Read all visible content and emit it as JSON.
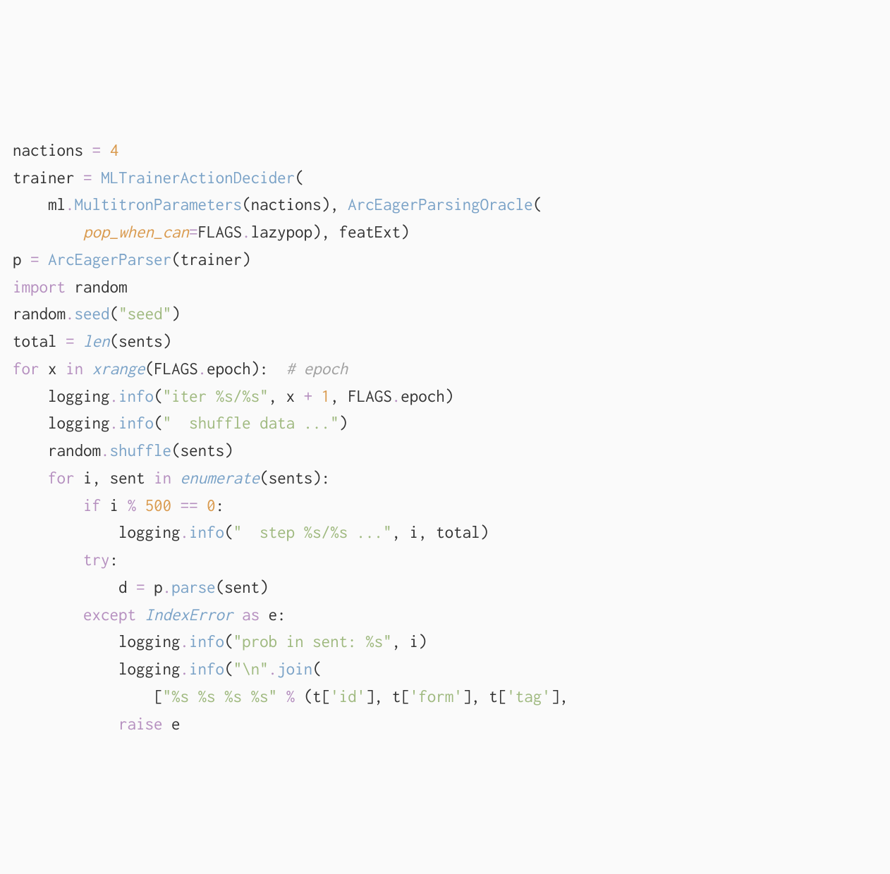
{
  "code": {
    "l1": {
      "var": "nactions",
      "eq": "=",
      "val": "4"
    },
    "l2": {
      "var": "trainer",
      "eq": "=",
      "cls": "MLTrainerActionDecider",
      "open": "("
    },
    "l3": {
      "obj": "ml",
      "dot": ".",
      "cls": "MultitronParameters",
      "open": "(",
      "arg": "nactions",
      "close": "), ",
      "cls2": "ArcEagerParsingOracle",
      "open2": "("
    },
    "l4": {
      "kwarg": "pop_when_can",
      "eq": "=",
      "obj": "FLAGS",
      "dot": ".",
      "attr": "lazypop",
      "close": "), ",
      "arg": "featExt",
      "close2": ")"
    },
    "l5": {
      "var": "p",
      "eq": "=",
      "cls": "ArcEagerParser",
      "open": "(",
      "arg": "trainer",
      "close": ")"
    },
    "l6": {
      "kw": "import",
      "mod": "random"
    },
    "l7": {
      "obj": "random",
      "dot": ".",
      "fn": "seed",
      "open": "(",
      "str": "\"seed\"",
      "close": ")"
    },
    "l8": {
      "var": "total",
      "eq": "=",
      "fn": "len",
      "open": "(",
      "arg": "sents",
      "close": ")"
    },
    "l9": {
      "kw": "for",
      "var": "x",
      "kw2": "in",
      "fn": "xrange",
      "open": "(",
      "obj": "FLAGS",
      "dot": ".",
      "attr": "epoch",
      "close": "):  ",
      "cmnt": "# epoch"
    },
    "l10": {
      "obj": "logging",
      "dot": ".",
      "fn": "info",
      "open": "(",
      "str": "\"iter %s/%s\"",
      "c1": ", ",
      "a1": "x",
      "op": "+",
      "n1": "1",
      "c2": ", ",
      "obj2": "FLAGS",
      "dot2": ".",
      "attr2": "epoch",
      "close": ")"
    },
    "l11": {
      "obj": "logging",
      "dot": ".",
      "fn": "info",
      "open": "(",
      "str": "\"  shuffle data ...\"",
      "close": ")"
    },
    "l12": {
      "obj": "random",
      "dot": ".",
      "fn": "shuffle",
      "open": "(",
      "arg": "sents",
      "close": ")"
    },
    "l13": {
      "kw": "for",
      "a1": "i",
      "c": ",",
      "a2": "sent",
      "kw2": "in",
      "fn": "enumerate",
      "open": "(",
      "arg": "sents",
      "close": "):"
    },
    "l14": {
      "kw": "if",
      "a1": "i",
      "op": "%",
      "n1": "500",
      "op2": "==",
      "n2": "0",
      "colon": ":"
    },
    "l15": {
      "obj": "logging",
      "dot": ".",
      "fn": "info",
      "open": "(",
      "str": "\"  step %s/%s ...\"",
      "c1": ", ",
      "a1": "i",
      "c2": ", ",
      "a2": "total",
      "close": ")"
    },
    "l16": {
      "kw": "try",
      "colon": ":"
    },
    "l17": {
      "var": "d",
      "eq": "=",
      "obj": "p",
      "dot": ".",
      "fn": "parse",
      "open": "(",
      "arg": "sent",
      "close": ")"
    },
    "l18": {
      "kw": "except",
      "exc": "IndexError",
      "kw2": "as",
      "var": "e",
      "colon": ":"
    },
    "l19": {
      "obj": "logging",
      "dot": ".",
      "fn": "info",
      "open": "(",
      "str": "\"prob in sent: %s\"",
      "c": ", ",
      "a": "i",
      "close": ")"
    },
    "l20": {
      "obj": "logging",
      "dot": ".",
      "fn": "info",
      "open": "(",
      "str": "\"\\n\"",
      "dot2": ".",
      "fn2": "join",
      "open2": "("
    },
    "l21": {
      "open": "[",
      "str": "\"%s %s %s %s\"",
      "op": "%",
      "popen": "(",
      "t1a": "t",
      "t1o": "[",
      "t1k": "'id'",
      "t1c": "]",
      "c1": ", ",
      "t2a": "t",
      "t2o": "[",
      "t2k": "'form'",
      "t2c": "]",
      "c2": ", ",
      "t3a": "t",
      "t3o": "[",
      "t3k": "'tag'",
      "t3c": "]",
      "tail": ","
    },
    "l22": {
      "kw": "raise",
      "var": "e"
    }
  }
}
